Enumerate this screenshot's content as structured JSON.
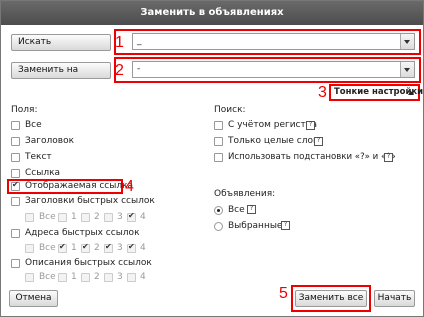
{
  "dialog": {
    "title": "Заменить в объявлениях"
  },
  "search": {
    "button_label": "Искать",
    "value": "_"
  },
  "replace": {
    "button_label": "Заменить на",
    "value": "-"
  },
  "fine_settings": {
    "label": "Тонкие настройки"
  },
  "annotations": {
    "n1": "1",
    "n2": "2",
    "n3": "3",
    "n4": "4",
    "n5": "5"
  },
  "fields": {
    "heading": "Поля:",
    "all": "Все",
    "title": "Заголовок",
    "text": "Текст",
    "link": "Ссылка",
    "display_link": "Отображаемая ссылка",
    "quick_link_titles": "Заголовки быстрых ссылок",
    "quick_link_urls": "Адреса быстрых ссылок",
    "quick_link_descriptions": "Описания быстрых ссылок",
    "sub_all": "Все",
    "sub_1": "1",
    "sub_2": "2",
    "sub_3": "3",
    "sub_4": "4"
  },
  "search_opts": {
    "heading": "Поиск:",
    "case": "С учётом регистра",
    "whole_words": "Только целые слова",
    "wildcards": "Использовать подстановки «?» и «*»",
    "help_mark": "?"
  },
  "ads": {
    "heading": "Объявления:",
    "all": "Все",
    "selected": "Выбранные"
  },
  "footer": {
    "cancel": "Отмена",
    "replace_all": "Заменить все",
    "start": "Начать"
  }
}
